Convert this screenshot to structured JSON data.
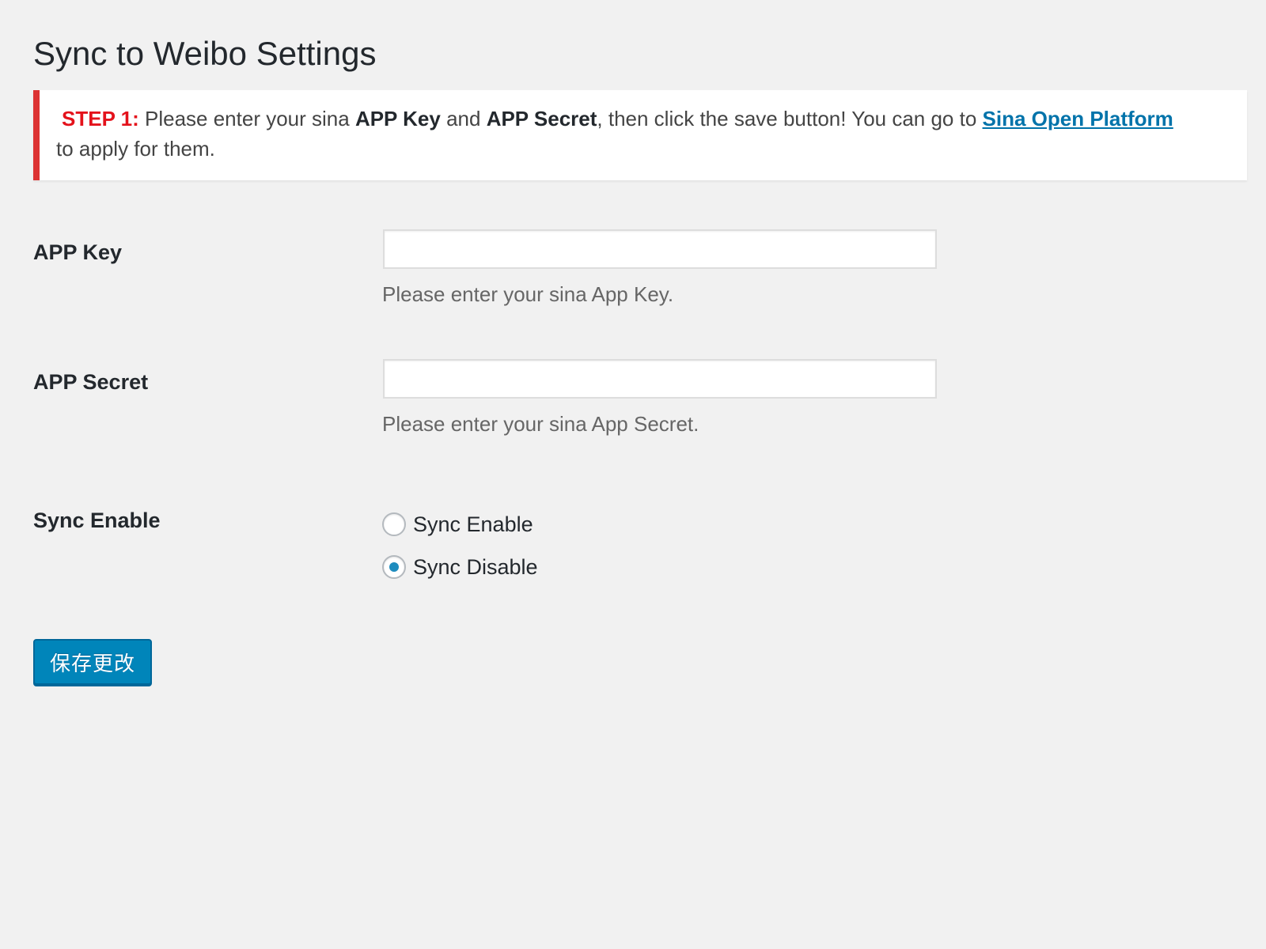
{
  "page": {
    "title": "Sync to Weibo Settings"
  },
  "notice": {
    "step_label": "STEP 1:",
    "text_1": " Please enter your sina ",
    "bold_app_key": "APP Key",
    "text_2": " and ",
    "bold_app_secret": "APP Secret",
    "text_3": ", then click the save button! You can go to ",
    "link_text": "Sina Open Platform",
    "text_4": " to apply for them.",
    "border_color": "#dc3232",
    "step_color": "#e4121b",
    "link_color": "#0073aa"
  },
  "fields": {
    "app_key": {
      "label": "APP Key",
      "value": "",
      "description": "Please enter your sina App Key."
    },
    "app_secret": {
      "label": "APP Secret",
      "value": "",
      "description": "Please enter your sina App Secret."
    },
    "sync_enable": {
      "label": "Sync Enable",
      "options": [
        {
          "label": "Sync Enable",
          "checked": false
        },
        {
          "label": "Sync Disable",
          "checked": true
        }
      ]
    }
  },
  "actions": {
    "save_label": "保存更改",
    "button_color": "#0085ba"
  }
}
